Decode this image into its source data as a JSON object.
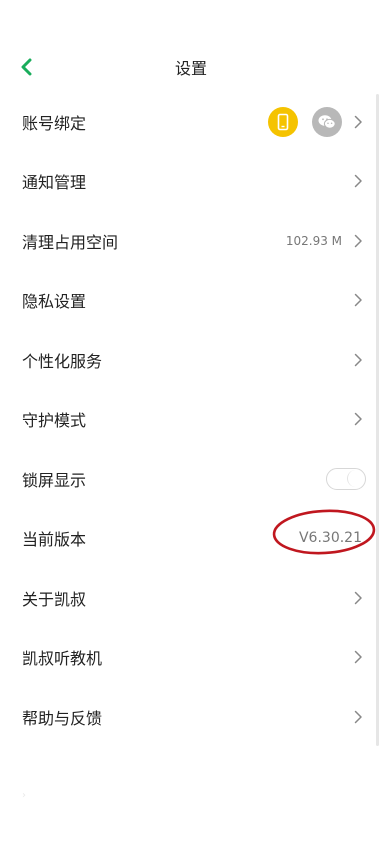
{
  "header": {
    "title": "设置",
    "back_icon": "chevron-left-icon",
    "accent": "#1aad5c"
  },
  "settings": {
    "account_binding": {
      "label": "账号绑定",
      "badges": [
        "phone-icon",
        "wechat-icon"
      ],
      "phone_color": "#f5c300",
      "wechat_color": "#b8b8b8"
    },
    "notification": {
      "label": "通知管理"
    },
    "clear_space": {
      "label": "清理占用空间",
      "value": "102.93 M"
    },
    "privacy": {
      "label": "隐私设置"
    },
    "personalization": {
      "label": "个性化服务"
    },
    "guardian_mode": {
      "label": "守护模式"
    },
    "lockscreen_display": {
      "label": "锁屏显示",
      "enabled": false
    },
    "current_version": {
      "label": "当前版本",
      "value": "V6.30.21",
      "highlight_color": "#c0171f"
    },
    "about": {
      "label": "关于凯叔"
    },
    "teaching_device": {
      "label": "凯叔听教机"
    },
    "help_feedback": {
      "label": "帮助与反馈"
    }
  }
}
